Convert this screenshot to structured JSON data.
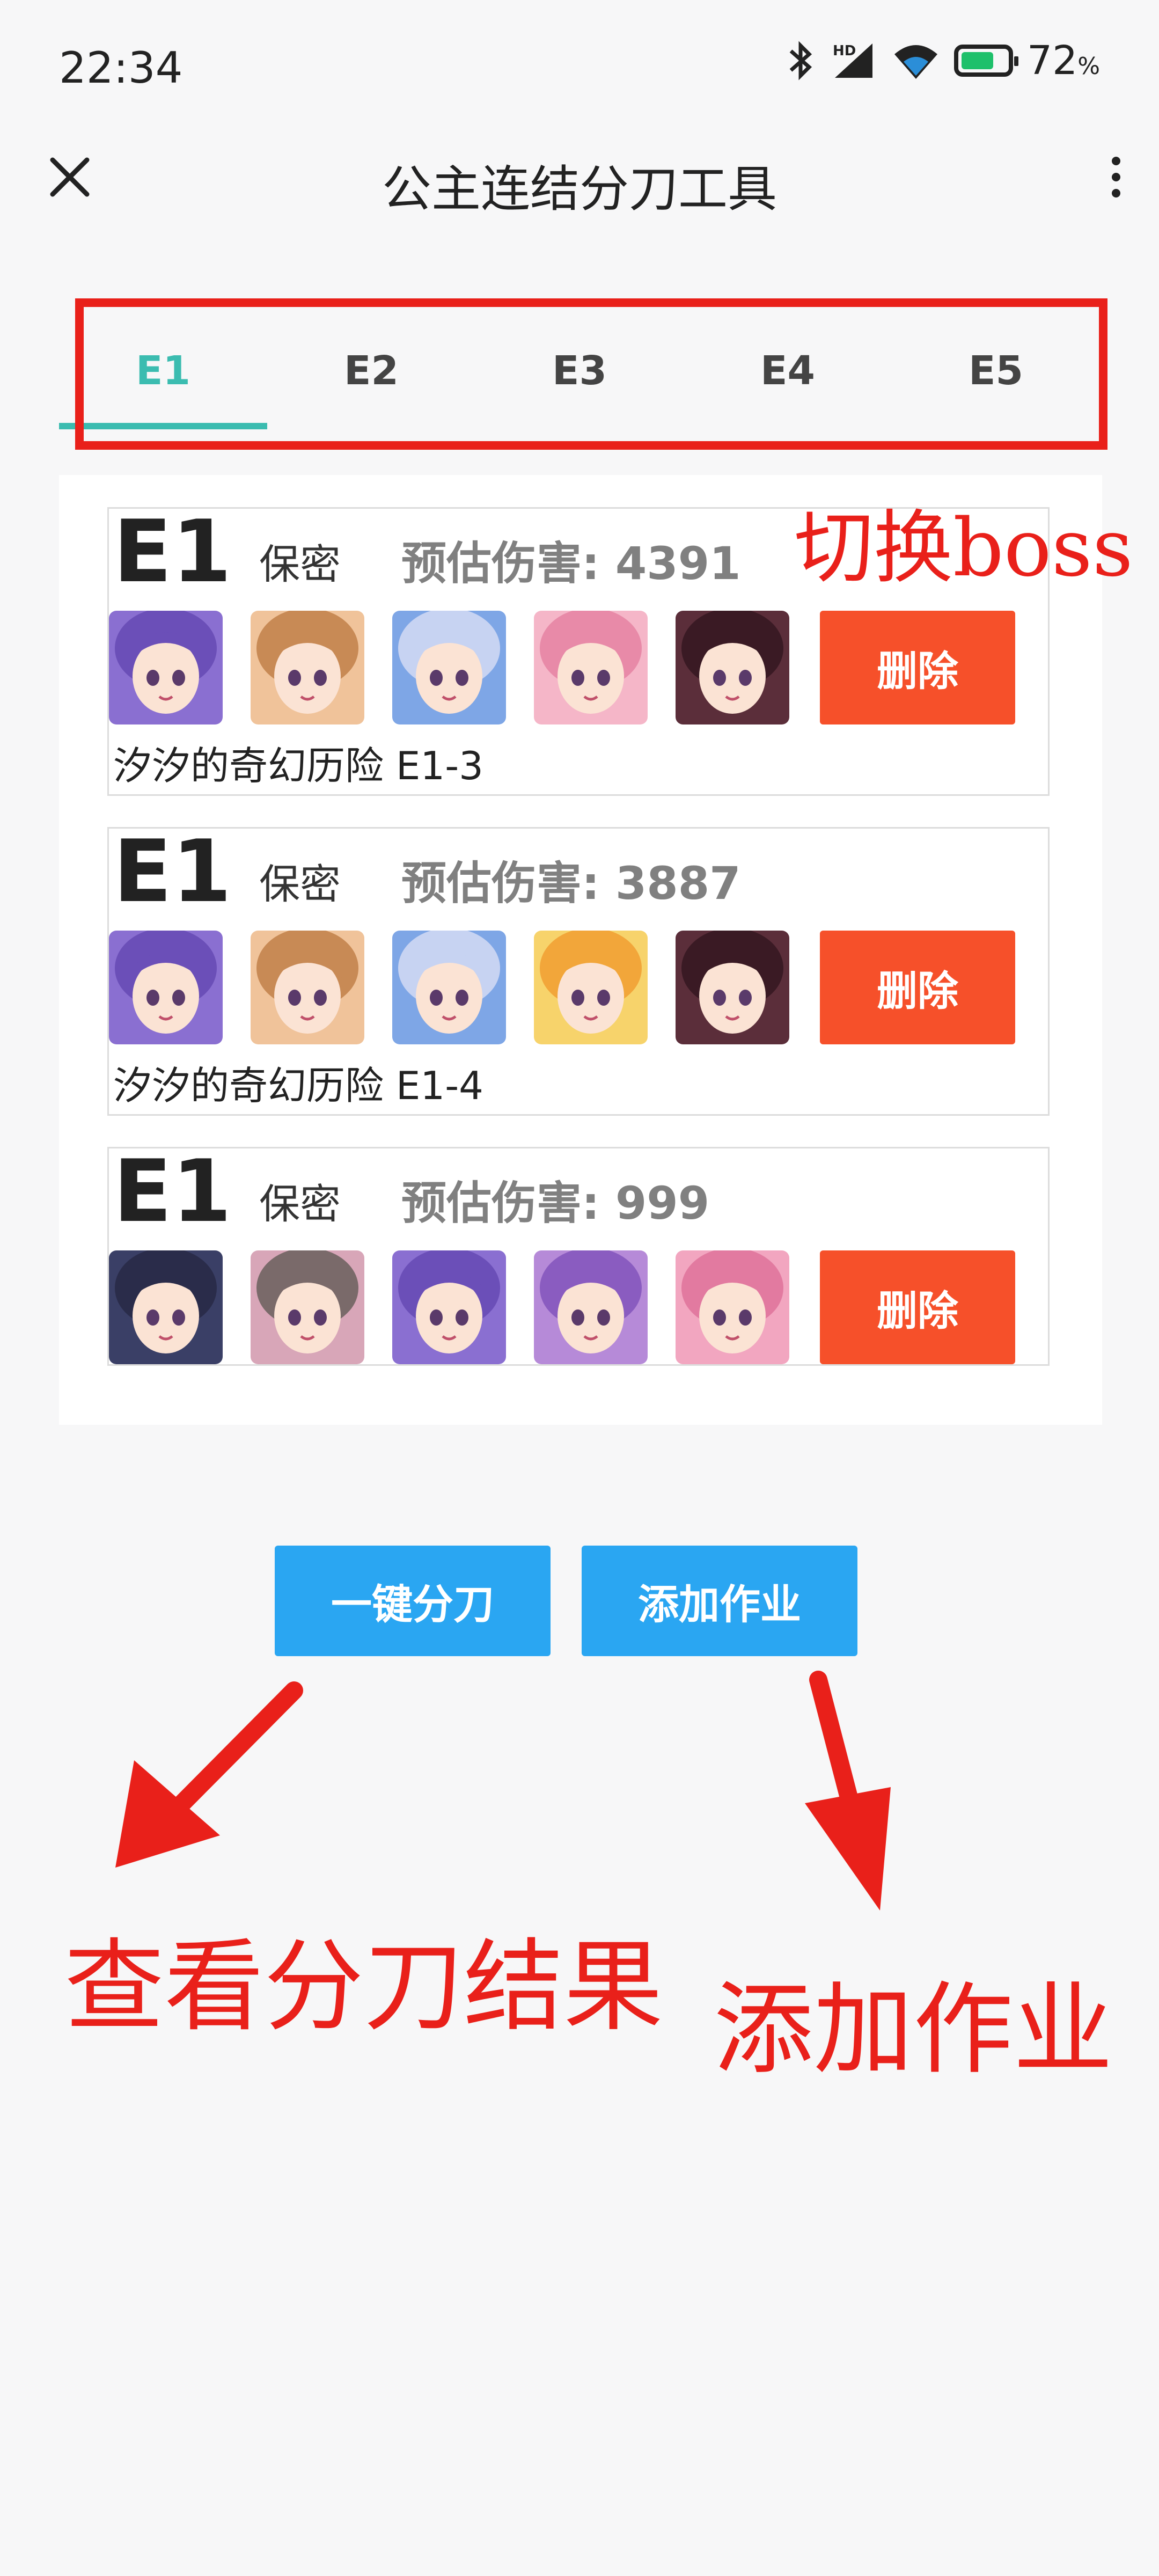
{
  "status_bar": {
    "time": "22:34",
    "battery_percent": "72",
    "battery_suffix": "%",
    "battery_level": 0.72,
    "icons": [
      "bluetooth-icon",
      "hd-signal-icon",
      "wifi-icon",
      "battery-icon"
    ]
  },
  "header": {
    "title": "公主连结分刀工具",
    "close_icon": "close-icon",
    "more_icon": "more-vertical-icon"
  },
  "tabs": [
    {
      "label": "E1",
      "active": true
    },
    {
      "label": "E2",
      "active": false
    },
    {
      "label": "E3",
      "active": false
    },
    {
      "label": "E4",
      "active": false
    },
    {
      "label": "E5",
      "active": false
    }
  ],
  "cards": [
    {
      "code": "E1",
      "tag": "保密",
      "damage_label": "预估伤害:",
      "damage": "4391",
      "delete_label": "删除",
      "note": "汐汐的奇幻历险 E1-3",
      "avatars": [
        {
          "hue": "#8a6fd1",
          "hair": "#6b4fb8"
        },
        {
          "hue": "#f0c39a",
          "hair": "#c88a55"
        },
        {
          "hue": "#7ea6e6",
          "hair": "#c7d3f2"
        },
        {
          "hue": "#f5b6c8",
          "hair": "#e88aa8"
        },
        {
          "hue": "#5b2e3a",
          "hair": "#3a1a24"
        }
      ]
    },
    {
      "code": "E1",
      "tag": "保密",
      "damage_label": "预估伤害:",
      "damage": "3887",
      "delete_label": "删除",
      "note": "汐汐的奇幻历险 E1-4",
      "avatars": [
        {
          "hue": "#8a6fd1",
          "hair": "#6b4fb8"
        },
        {
          "hue": "#f0c39a",
          "hair": "#c88a55"
        },
        {
          "hue": "#7ea6e6",
          "hair": "#c7d3f2"
        },
        {
          "hue": "#f7d36b",
          "hair": "#f2a63a"
        },
        {
          "hue": "#5b2e3a",
          "hair": "#3a1a24"
        }
      ]
    },
    {
      "code": "E1",
      "tag": "保密",
      "damage_label": "预估伤害:",
      "damage": "999",
      "delete_label": "删除",
      "note": "",
      "avatars": [
        {
          "hue": "#3a3f66",
          "hair": "#2a2c4a"
        },
        {
          "hue": "#d8a6b8",
          "hair": "#7a6a6a"
        },
        {
          "hue": "#8a6fd1",
          "hair": "#6b4fb8"
        },
        {
          "hue": "#b68ad8",
          "hair": "#8a5cc0"
        },
        {
          "hue": "#f2a6c0",
          "hair": "#e27aa0"
        }
      ]
    }
  ],
  "actions": {
    "split_label": "一键分刀",
    "add_label": "添加作业"
  },
  "annotations": {
    "switch_boss": "切换boss",
    "view_result": "查看分刀结果",
    "add_job": "添加作业"
  },
  "colors": {
    "accent_tab": "#3bbcb0",
    "delete_button": "#f6502a",
    "primary_button": "#2aa6f2",
    "annotation_red": "#e9201a"
  }
}
